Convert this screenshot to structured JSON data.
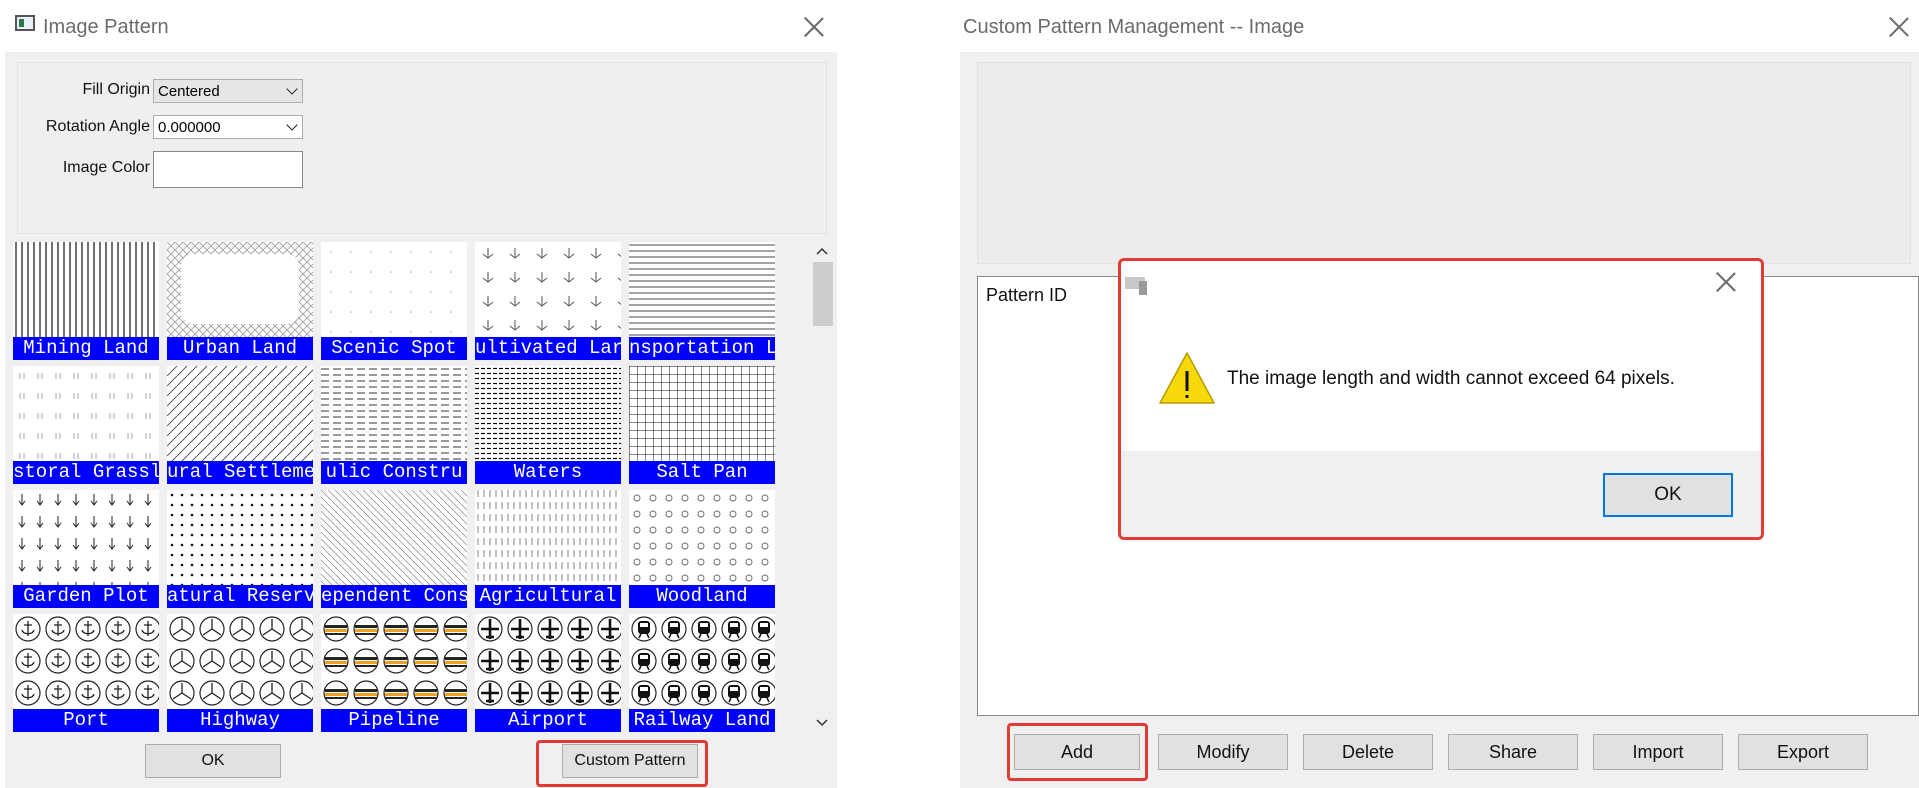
{
  "left_window": {
    "title": "Image Pattern",
    "fields": {
      "fill_origin_label": "Fill Origin",
      "fill_origin_value": "Centered",
      "rotation_label": "Rotation Angle",
      "rotation_value": "0.000000",
      "image_color_label": "Image Color",
      "image_color_value": ""
    },
    "patterns": [
      {
        "label": "Mining Land",
        "icon": "vertical-lines-pattern"
      },
      {
        "label": "Urban Land",
        "icon": "crosshatch-border-pattern"
      },
      {
        "label": "Scenic Spot",
        "icon": "sparse-dots-pattern"
      },
      {
        "label": "ultivated Lar",
        "icon": "tree-symbol-pattern"
      },
      {
        "label": "nsportation L",
        "icon": "horizontal-lines-pattern"
      },
      {
        "label": "storal Grassl",
        "icon": "grass-tick-pattern"
      },
      {
        "label": "ural Settleme",
        "icon": "diagonal-lines-pattern"
      },
      {
        "label": "ulic Constru",
        "icon": "dashed-lines-pattern"
      },
      {
        "label": "Waters",
        "icon": "dense-dashed-lines-pattern"
      },
      {
        "label": "Salt Pan",
        "icon": "grid-pattern"
      },
      {
        "label": "Garden Plot",
        "icon": "arrow-down-pattern"
      },
      {
        "label": "atural Reserv",
        "icon": "dot-grid-pattern"
      },
      {
        "label": "ependent Cons",
        "icon": "thin-diagonal-pattern"
      },
      {
        "label": "Agricultural",
        "icon": "vertical-dashes-pattern"
      },
      {
        "label": "Woodland",
        "icon": "circle-pattern"
      },
      {
        "label": "Port",
        "icon": "anchor-icon-pattern"
      },
      {
        "label": "Highway",
        "icon": "three-spoke-icon-pattern"
      },
      {
        "label": "Pipeline",
        "icon": "pipeline-icon-pattern"
      },
      {
        "label": "Airport",
        "icon": "airplane-icon-pattern"
      },
      {
        "label": "Railway Land",
        "icon": "train-icon-pattern"
      }
    ],
    "ok_label": "OK",
    "custom_pattern_label": "Custom Pattern"
  },
  "right_window": {
    "title": "Custom Pattern Management -- Image",
    "list_header": "Pattern ID",
    "buttons": {
      "add": "Add",
      "modify": "Modify",
      "delete": "Delete",
      "share": "Share",
      "import": "Import",
      "export": "Export"
    }
  },
  "dialog": {
    "message": "The image length and width cannot exceed 64 pixels.",
    "ok_label": "OK",
    "icon": "warning-icon"
  },
  "colors": {
    "caption_bg": "#0000ff",
    "highlight": "#e23b33",
    "warning": "#f5d90a"
  }
}
